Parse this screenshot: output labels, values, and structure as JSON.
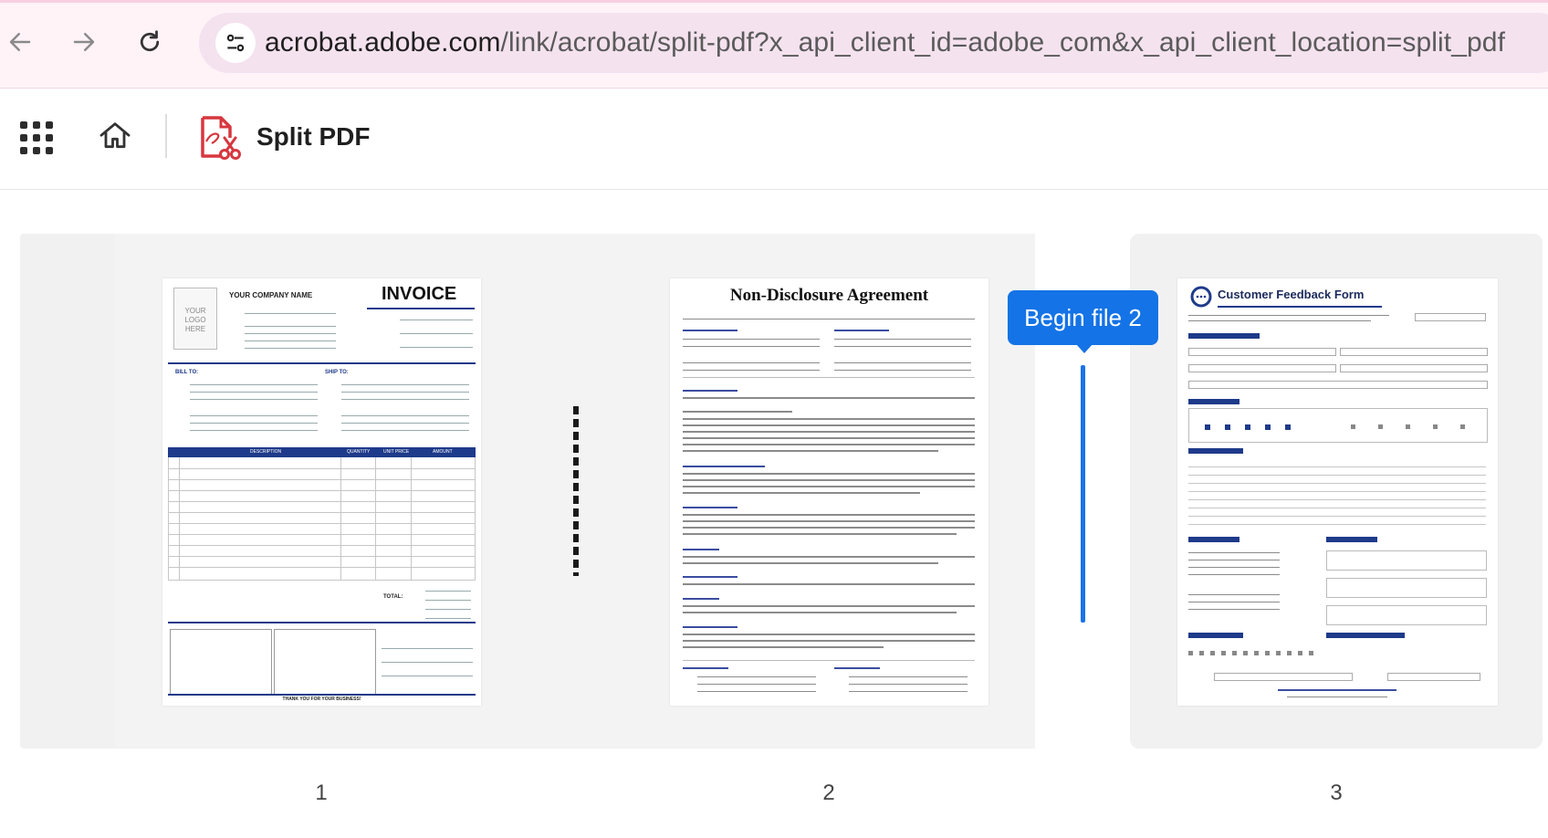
{
  "browser": {
    "url_host": "acrobat.adobe.com",
    "url_path": "/link/acrobat/split-pdf?x_api_client_id=adobe_com&x_api_client_location=split_pdf",
    "back_icon": "arrow-left-icon",
    "forward_icon": "arrow-right-icon",
    "reload_icon": "reload-icon",
    "site_info_icon": "tune-icon"
  },
  "app": {
    "tool_title": "Split PDF",
    "apps_icon": "apps-grid-icon",
    "home_icon": "home-icon",
    "tool_icon": "split-pdf-icon",
    "accent": "#1473e6",
    "tool_icon_color": "#d7373f"
  },
  "split": {
    "marker_label": "Begin file 2"
  },
  "pages": [
    {
      "number": "1",
      "content": {
        "logo_text": "YOUR LOGO HERE",
        "company": "YOUR COMPANY NAME",
        "title": "INVOICE",
        "bill_to": "BILL TO:",
        "ship_to": "SHIP TO:",
        "col_desc": "DESCRIPTION",
        "col_qty": "QUANTITY",
        "col_unit": "UNIT PRICE",
        "col_amount": "AMOUNT",
        "total": "TOTAL:",
        "thanks": "THANK YOU FOR YOUR BUSINESS!"
      }
    },
    {
      "number": "2",
      "content": {
        "title": "Non-Disclosure Agreement"
      }
    },
    {
      "number": "3",
      "content": {
        "title": "Customer Feedback Form"
      }
    }
  ]
}
